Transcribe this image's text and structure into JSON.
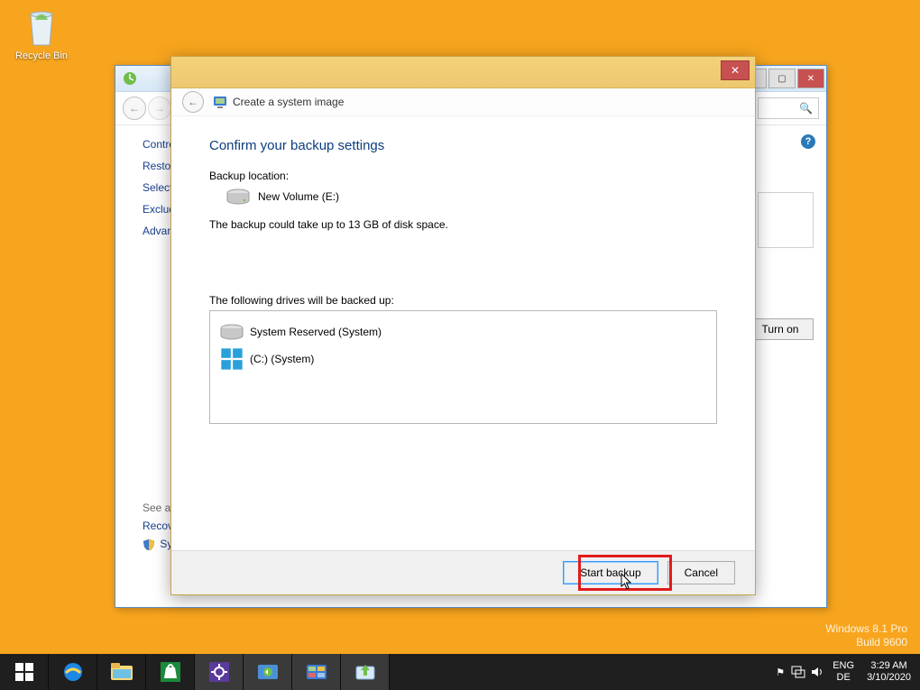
{
  "desktop": {
    "recycle_label": "Recycle Bin",
    "watermark_line1": "Windows 8.1 Pro",
    "watermark_line2": "Build 9600"
  },
  "bg_window": {
    "side_links": [
      "Contro",
      "Restor",
      "Select",
      "Exclud",
      "Advan"
    ],
    "see_also_header": "See als",
    "see_also_links": [
      "Recov",
      "Syster"
    ],
    "turn_on": "Turn on"
  },
  "dialog": {
    "title": "Create a system image",
    "heading": "Confirm your backup settings",
    "backup_location_label": "Backup location:",
    "backup_location_value": "New Volume (E:)",
    "space_note": "The backup could take up to 13 GB of disk space.",
    "drives_header": "The following drives will be backed up:",
    "drives": [
      "System Reserved (System)",
      "(C:) (System)"
    ],
    "start_btn": "Start backup",
    "cancel_btn": "Cancel"
  },
  "taskbar": {
    "lang1": "ENG",
    "lang2": "DE",
    "time": "3:29 AM",
    "date": "3/10/2020"
  }
}
